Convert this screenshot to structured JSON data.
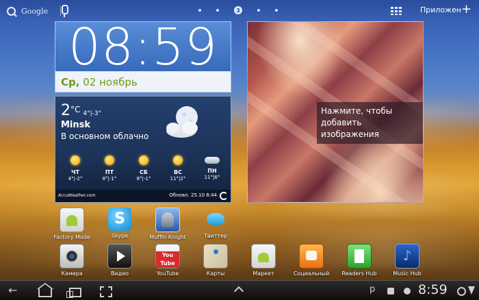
{
  "top_bar": {
    "search_brand": "Google",
    "current_page": "3",
    "apps_label": "Приложен",
    "add_symbol": "+"
  },
  "clock_widget": {
    "time": "08:59",
    "weekday": "Ср,",
    "date": " 02 ноябрь"
  },
  "weather_widget": {
    "temperature": "2",
    "unit": "°C",
    "range": "4°|-3°",
    "city": "Minsk",
    "condition": "В основном облачно",
    "forecast": [
      {
        "day": "ЧТ",
        "temps": "4°|-2°",
        "icon": "sun-icon"
      },
      {
        "day": "ПТ",
        "temps": "8°|-1°",
        "icon": "sun-icon"
      },
      {
        "day": "СБ",
        "temps": "8°|-1°",
        "icon": "sun-icon"
      },
      {
        "day": "ВС",
        "temps": "11°|2°",
        "icon": "sun-icon"
      },
      {
        "day": "ПН",
        "temps": "11°|6°",
        "icon": "cloud-icon"
      }
    ],
    "provider": "AccuWeather.com",
    "updated": "Обновл. 25.10 8:44"
  },
  "photo_widget": {
    "caption": "Нажмите, чтобы добавить изображения"
  },
  "apps_row1": [
    {
      "label": "Factory Mode",
      "icon": "factory-mode-icon"
    },
    {
      "label": "Skype",
      "icon": "skype-icon"
    },
    {
      "label": "Muffin Knight",
      "icon": "muffin-knight-icon"
    },
    {
      "label": "Твиттер",
      "icon": "twitter-icon"
    }
  ],
  "apps_row2": [
    {
      "label": "Камера",
      "icon": "camera-icon"
    },
    {
      "label": "Видео",
      "icon": "video-icon"
    },
    {
      "label": "YouTube",
      "icon": "youtube-icon"
    },
    {
      "label": "Карты",
      "icon": "maps-icon"
    },
    {
      "label": "Маркет",
      "icon": "market-icon"
    },
    {
      "label": "Социальный",
      "icon": "social-icon"
    },
    {
      "label": "Readers Hub",
      "icon": "readers-hub-icon"
    },
    {
      "label": "Music Hub",
      "icon": "music-hub-icon"
    }
  ],
  "status_bar": {
    "clock": "8:59",
    "notification_letter": "р"
  }
}
